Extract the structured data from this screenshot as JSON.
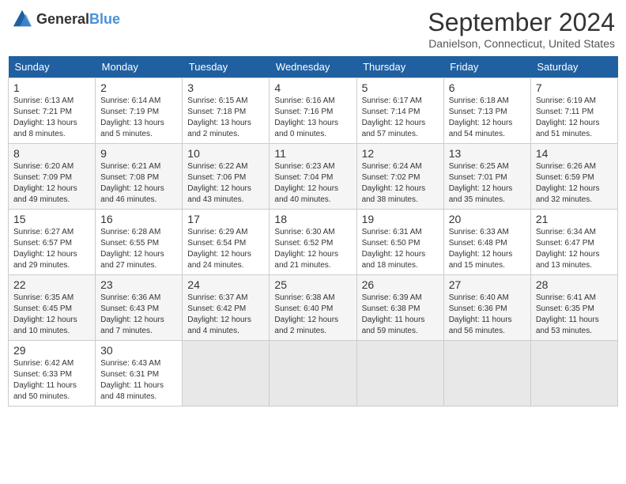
{
  "header": {
    "logo_general": "General",
    "logo_blue": "Blue",
    "month_year": "September 2024",
    "location": "Danielson, Connecticut, United States"
  },
  "calendar": {
    "days_of_week": [
      "Sunday",
      "Monday",
      "Tuesday",
      "Wednesday",
      "Thursday",
      "Friday",
      "Saturday"
    ],
    "weeks": [
      [
        {
          "day": "1",
          "sunrise": "6:13 AM",
          "sunset": "7:21 PM",
          "daylight": "13 hours and 8 minutes."
        },
        {
          "day": "2",
          "sunrise": "6:14 AM",
          "sunset": "7:19 PM",
          "daylight": "13 hours and 5 minutes."
        },
        {
          "day": "3",
          "sunrise": "6:15 AM",
          "sunset": "7:18 PM",
          "daylight": "13 hours and 2 minutes."
        },
        {
          "day": "4",
          "sunrise": "6:16 AM",
          "sunset": "7:16 PM",
          "daylight": "13 hours and 0 minutes."
        },
        {
          "day": "5",
          "sunrise": "6:17 AM",
          "sunset": "7:14 PM",
          "daylight": "12 hours and 57 minutes."
        },
        {
          "day": "6",
          "sunrise": "6:18 AM",
          "sunset": "7:13 PM",
          "daylight": "12 hours and 54 minutes."
        },
        {
          "day": "7",
          "sunrise": "6:19 AM",
          "sunset": "7:11 PM",
          "daylight": "12 hours and 51 minutes."
        }
      ],
      [
        {
          "day": "8",
          "sunrise": "6:20 AM",
          "sunset": "7:09 PM",
          "daylight": "12 hours and 49 minutes."
        },
        {
          "day": "9",
          "sunrise": "6:21 AM",
          "sunset": "7:08 PM",
          "daylight": "12 hours and 46 minutes."
        },
        {
          "day": "10",
          "sunrise": "6:22 AM",
          "sunset": "7:06 PM",
          "daylight": "12 hours and 43 minutes."
        },
        {
          "day": "11",
          "sunrise": "6:23 AM",
          "sunset": "7:04 PM",
          "daylight": "12 hours and 40 minutes."
        },
        {
          "day": "12",
          "sunrise": "6:24 AM",
          "sunset": "7:02 PM",
          "daylight": "12 hours and 38 minutes."
        },
        {
          "day": "13",
          "sunrise": "6:25 AM",
          "sunset": "7:01 PM",
          "daylight": "12 hours and 35 minutes."
        },
        {
          "day": "14",
          "sunrise": "6:26 AM",
          "sunset": "6:59 PM",
          "daylight": "12 hours and 32 minutes."
        }
      ],
      [
        {
          "day": "15",
          "sunrise": "6:27 AM",
          "sunset": "6:57 PM",
          "daylight": "12 hours and 29 minutes."
        },
        {
          "day": "16",
          "sunrise": "6:28 AM",
          "sunset": "6:55 PM",
          "daylight": "12 hours and 27 minutes."
        },
        {
          "day": "17",
          "sunrise": "6:29 AM",
          "sunset": "6:54 PM",
          "daylight": "12 hours and 24 minutes."
        },
        {
          "day": "18",
          "sunrise": "6:30 AM",
          "sunset": "6:52 PM",
          "daylight": "12 hours and 21 minutes."
        },
        {
          "day": "19",
          "sunrise": "6:31 AM",
          "sunset": "6:50 PM",
          "daylight": "12 hours and 18 minutes."
        },
        {
          "day": "20",
          "sunrise": "6:33 AM",
          "sunset": "6:48 PM",
          "daylight": "12 hours and 15 minutes."
        },
        {
          "day": "21",
          "sunrise": "6:34 AM",
          "sunset": "6:47 PM",
          "daylight": "12 hours and 13 minutes."
        }
      ],
      [
        {
          "day": "22",
          "sunrise": "6:35 AM",
          "sunset": "6:45 PM",
          "daylight": "12 hours and 10 minutes."
        },
        {
          "day": "23",
          "sunrise": "6:36 AM",
          "sunset": "6:43 PM",
          "daylight": "12 hours and 7 minutes."
        },
        {
          "day": "24",
          "sunrise": "6:37 AM",
          "sunset": "6:42 PM",
          "daylight": "12 hours and 4 minutes."
        },
        {
          "day": "25",
          "sunrise": "6:38 AM",
          "sunset": "6:40 PM",
          "daylight": "12 hours and 2 minutes."
        },
        {
          "day": "26",
          "sunrise": "6:39 AM",
          "sunset": "6:38 PM",
          "daylight": "11 hours and 59 minutes."
        },
        {
          "day": "27",
          "sunrise": "6:40 AM",
          "sunset": "6:36 PM",
          "daylight": "11 hours and 56 minutes."
        },
        {
          "day": "28",
          "sunrise": "6:41 AM",
          "sunset": "6:35 PM",
          "daylight": "11 hours and 53 minutes."
        }
      ],
      [
        {
          "day": "29",
          "sunrise": "6:42 AM",
          "sunset": "6:33 PM",
          "daylight": "11 hours and 50 minutes."
        },
        {
          "day": "30",
          "sunrise": "6:43 AM",
          "sunset": "6:31 PM",
          "daylight": "11 hours and 48 minutes."
        },
        null,
        null,
        null,
        null,
        null
      ]
    ]
  }
}
